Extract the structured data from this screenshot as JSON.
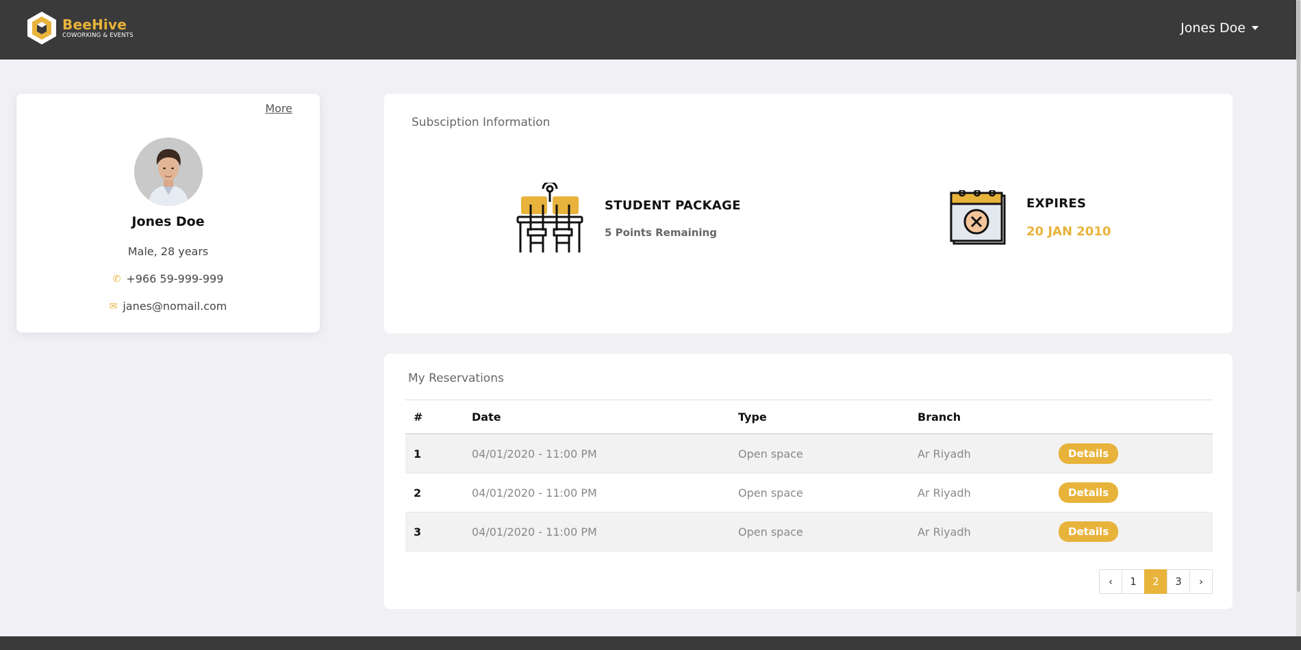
{
  "brand": {
    "name": "BeeHive",
    "tagline": "COWORKING & EVENTS",
    "accent": "#e8b33b"
  },
  "header": {
    "user_name": "Jones Doe",
    "icon": "chevron-down-icon"
  },
  "profile": {
    "more_label": "More",
    "name": "Jones Doe",
    "gender_age": "Male, 28 years",
    "phone": "+966 59-999-999",
    "email": "janes@nomail.com"
  },
  "subscription": {
    "title": "Subsciption Information",
    "package_title": "STUDENT PACKAGE",
    "package_points": "5 Points Remaining",
    "expires_label": "EXPIRES",
    "expires_date": "20 JAN 2010"
  },
  "reservations": {
    "title": "My Reservations",
    "columns": [
      "#",
      "Date",
      "Type",
      "Branch",
      ""
    ],
    "rows": [
      {
        "num": "1",
        "date": "04/01/2020 - 11:00 PM",
        "type": "Open space",
        "branch": "Ar Riyadh",
        "action": "Details"
      },
      {
        "num": "2",
        "date": "04/01/2020 - 11:00 PM",
        "type": "Open space",
        "branch": "Ar Riyadh",
        "action": "Details"
      },
      {
        "num": "3",
        "date": "04/01/2020 - 11:00 PM",
        "type": "Open space",
        "branch": "Ar Riyadh",
        "action": "Details"
      }
    ],
    "pagination": {
      "prev": "‹",
      "pages": [
        "1",
        "2",
        "3"
      ],
      "active": "2",
      "next": "›"
    }
  }
}
